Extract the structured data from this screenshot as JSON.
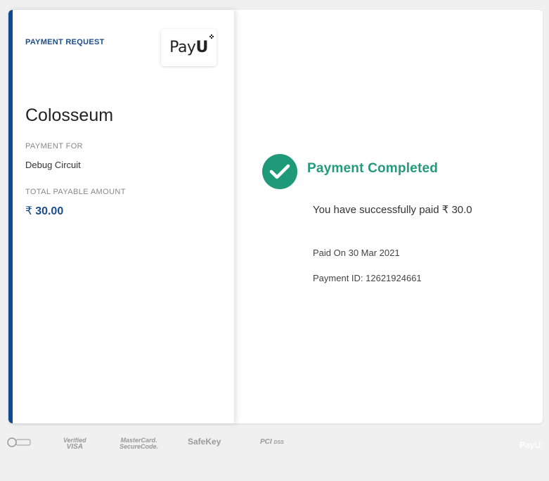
{
  "left": {
    "request_label": "PAYMENT REQUEST",
    "logo": {
      "text_plain": "Pay",
      "text_bold": "U"
    },
    "merchant_name": "Colosseum",
    "payment_for_label": "PAYMENT FOR",
    "payment_for_value": "Debug Circuit",
    "total_label": "TOTAL PAYABLE AMOUNT",
    "currency_symbol": "₹",
    "total_amount": "30.00"
  },
  "right": {
    "status_icon": "check-icon",
    "status_title": "Payment Completed",
    "success_message": "You have successfully paid ₹ 30.0",
    "paid_on": "Paid On 30 Mar 2021",
    "payment_id": "Payment ID: 12621924661"
  },
  "footer": {
    "badges": [
      {
        "line1": "PayPass",
        "line2": ""
      },
      {
        "line1": "Verified",
        "line2": "VISA"
      },
      {
        "line1": "MasterCard.",
        "line2": "SecureCode."
      },
      {
        "line1": "",
        "line2": "SafeKey"
      },
      {
        "line1": "PCI",
        "line2": "DSS"
      }
    ],
    "logo_text": "PayU"
  },
  "colors": {
    "accent_blue": "#1a4d8c",
    "success_green": "#1e9a78",
    "background": "#f0f0f0"
  }
}
